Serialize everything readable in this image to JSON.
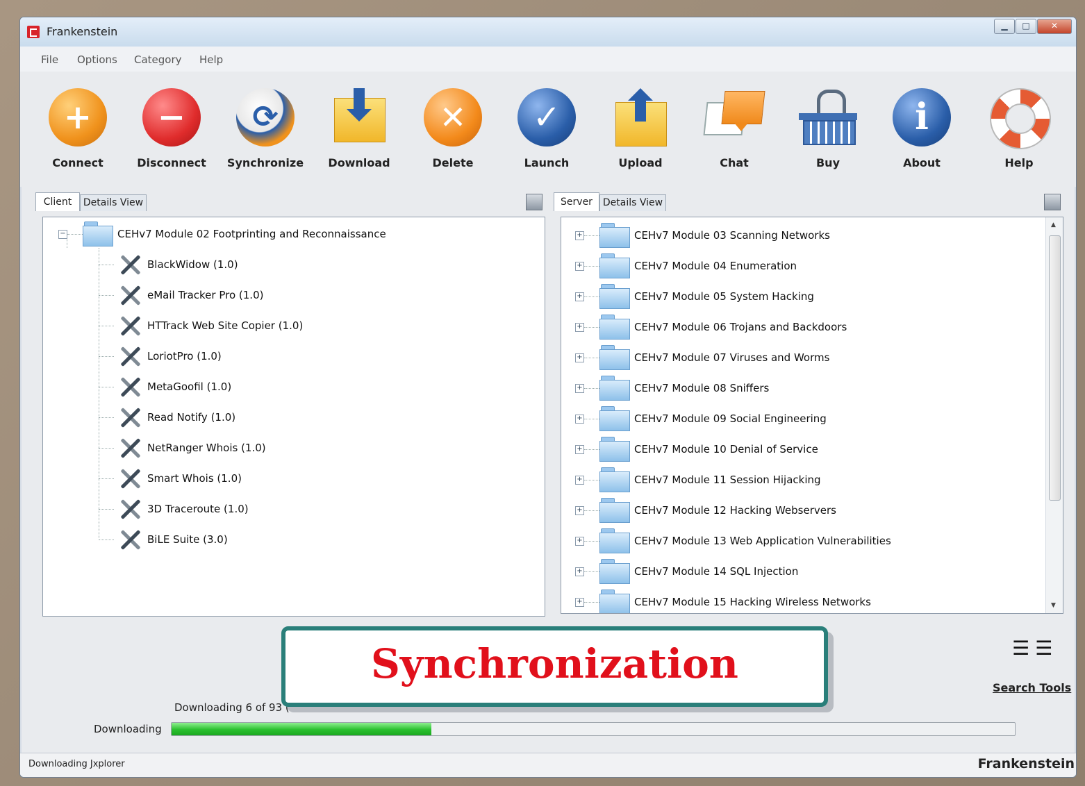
{
  "window": {
    "title": "Frankenstein"
  },
  "menu": [
    "File",
    "Options",
    "Category",
    "Help"
  ],
  "toolbar": [
    {
      "label": "Connect",
      "icon": "plus-circle-icon",
      "color": "#f0921c"
    },
    {
      "label": "Disconnect",
      "icon": "minus-circle-icon",
      "color": "#e02c2c"
    },
    {
      "label": "Synchronize",
      "icon": "sync-icon",
      "color": "#3a6fb6"
    },
    {
      "label": "Download",
      "icon": "download-folder-icon",
      "color": "#f4c64d"
    },
    {
      "label": "Delete",
      "icon": "delete-x-icon",
      "color": "#f38a1b"
    },
    {
      "label": "Launch",
      "icon": "launch-check-icon",
      "color": "#2a5ea9"
    },
    {
      "label": "Upload",
      "icon": "upload-folder-icon",
      "color": "#f4c64d"
    },
    {
      "label": "Chat",
      "icon": "chat-bubble-icon",
      "color": "#f08a1c"
    },
    {
      "label": "Buy",
      "icon": "basket-icon",
      "color": "#4f7fc1"
    },
    {
      "label": "About",
      "icon": "info-icon",
      "color": "#2a5ea9"
    },
    {
      "label": "Help",
      "icon": "lifebuoy-icon",
      "color": "#e55b33"
    }
  ],
  "client": {
    "tabs": [
      "Client",
      "Details View"
    ],
    "root": "CEHv7 Module 02 Footprinting and Reconnaissance",
    "items": [
      "BlackWidow (1.0)",
      "eMail Tracker Pro (1.0)",
      "HTTrack Web Site Copier (1.0)",
      "LoriotPro (1.0)",
      "MetaGoofil (1.0)",
      "Read Notify (1.0)",
      "NetRanger Whois (1.0)",
      "Smart Whois (1.0)",
      "3D Traceroute (1.0)",
      "BiLE Suite (3.0)"
    ]
  },
  "server": {
    "tabs": [
      "Server",
      "Details View"
    ],
    "items": [
      "CEHv7 Module 03 Scanning Networks",
      "CEHv7 Module 04 Enumeration",
      "CEHv7 Module 05 System Hacking",
      "CEHv7 Module 06 Trojans and Backdoors",
      "CEHv7 Module 07 Viruses and Worms",
      "CEHv7 Module 08 Sniffers",
      "CEHv7 Module 09 Social Engineering",
      "CEHv7 Module 10 Denial of Service",
      "CEHv7 Module 11 Session Hijacking",
      "CEHv7 Module 12 Hacking Webservers",
      "CEHv7 Module 13 Web Application Vulnerabilities",
      "CEHv7 Module 14 SQL Injection",
      "CEHv7 Module 15 Hacking Wireless Networks"
    ]
  },
  "overlay": {
    "text": "Synchronization"
  },
  "status": {
    "downloading_count": "Downloading 6 of 93 (100%)",
    "downloading_label": "Downloading",
    "progress_fraction": 0.308,
    "search_tools": "Search Tools",
    "statusbar_text": "Downloading Jxplorer",
    "brand": "Frankenstein"
  }
}
